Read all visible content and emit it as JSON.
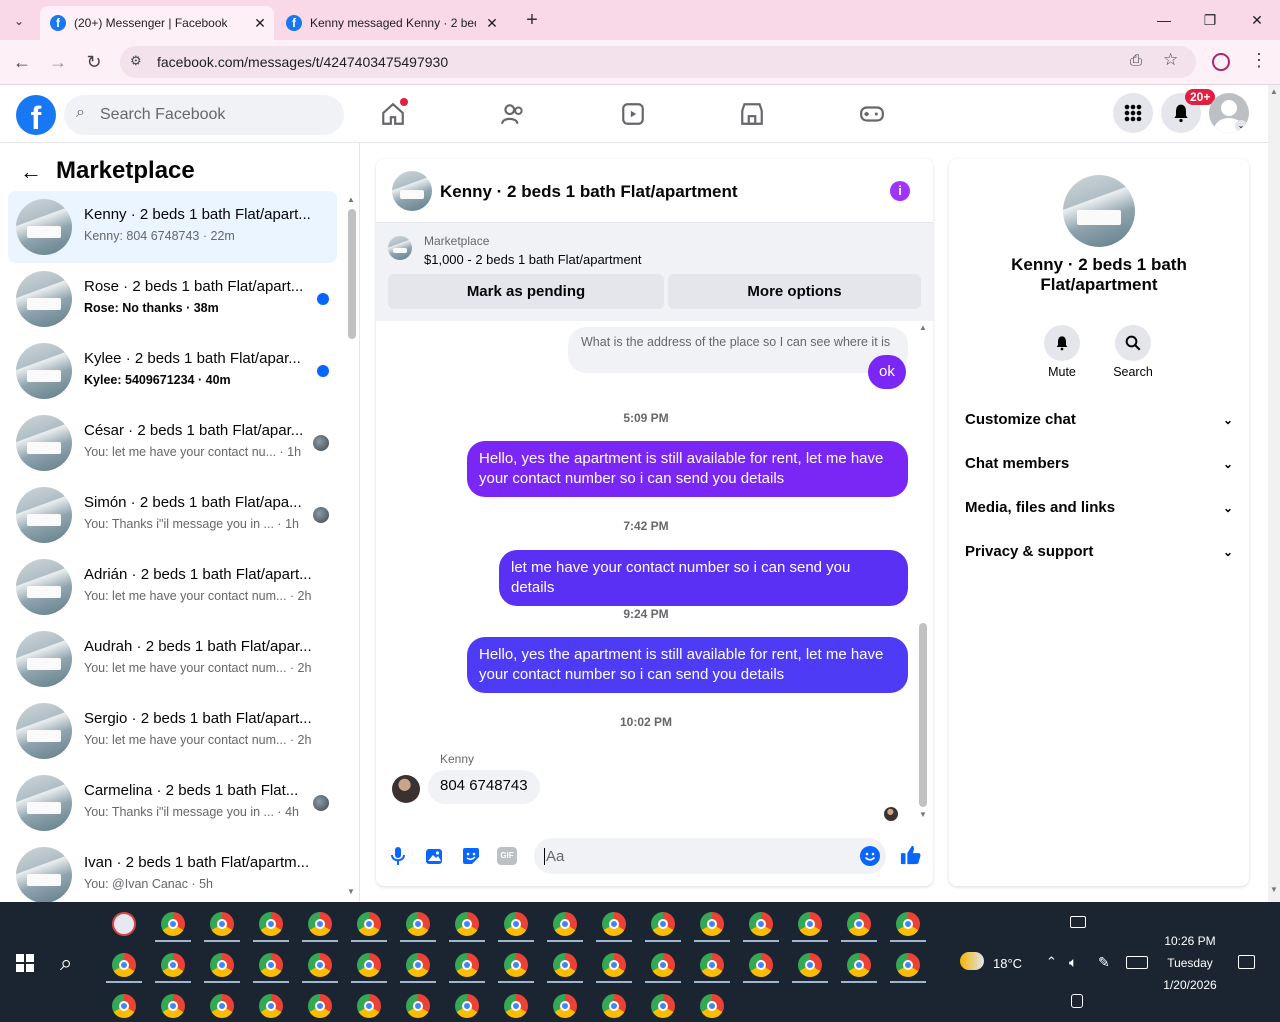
{
  "browser": {
    "tabs": [
      {
        "title": "(20+) Messenger | Facebook",
        "close": "✕"
      },
      {
        "title": "Kenny messaged Kenny · 2 bed",
        "close": "✕"
      }
    ],
    "new_tab": "+",
    "url": "facebook.com/messages/t/4247403475497930"
  },
  "fb": {
    "logo": "f",
    "search_placeholder": "Search Facebook",
    "notif_badge": "20+"
  },
  "sidebar": {
    "title": "Marketplace",
    "conversations": [
      {
        "name": "Kenny · 2 beds 1 bath Flat/apart...",
        "preview": "Kenny: 804 6748743 · 22m",
        "selected": true,
        "unread": false
      },
      {
        "name": "Rose · 2 beds 1 bath Flat/apart...",
        "preview": "Rose: No thanks · 38m",
        "unread": true
      },
      {
        "name": "Kylee · 2 beds 1 bath Flat/apar...",
        "preview": "Kylee: 5409671234 · 40m",
        "unread": true
      },
      {
        "name": "César · 2 beds 1 bath Flat/apar...",
        "preview": "You: let me have your contact nu... · 1h",
        "seen": true
      },
      {
        "name": "Simón · 2 beds 1 bath Flat/apa...",
        "preview": "You: Thanks i\"il message you in ... · 1h",
        "seen": true
      },
      {
        "name": "Adrián · 2 beds 1 bath Flat/apart...",
        "preview": "You: let me have your contact num... · 2h"
      },
      {
        "name": "Audrah · 2 beds 1 bath Flat/apar...",
        "preview": "You: let me have your contact num... · 2h"
      },
      {
        "name": "Sergio · 2 beds 1 bath Flat/apart...",
        "preview": "You: let me have your contact num... · 2h"
      },
      {
        "name": "Carmelina · 2 beds 1 bath Flat...",
        "preview": "You: Thanks i\"il message you in ... · 4h",
        "seen": true
      },
      {
        "name": "Ivan · 2 beds 1 bath Flat/apartm...",
        "preview": "You: @Ivan Canac · 5h"
      }
    ]
  },
  "chat": {
    "title": "Kenny · 2 beds 1 bath Flat/apartment",
    "marketplace_label": "Marketplace",
    "listing": "$1,000 - 2 beds 1 bath Flat/apartment",
    "mark_pending": "Mark as pending",
    "more_options": "More options",
    "messages": {
      "quoted": "What is the address of the place so I can see where it is",
      "ok": "ok",
      "time1": "5:09 PM",
      "msg1": "Hello, yes the apartment is still available for rent, let me have your contact number so i can send you details",
      "time2": "7:42 PM",
      "msg2": "let me have your contact number so i can send you details",
      "time3": "9:24 PM",
      "msg3": "Hello, yes the apartment is still available for rent, let me have your contact number so i can send you details",
      "time4": "10:02 PM",
      "sender": "Kenny",
      "incoming": "804 6748743"
    },
    "input_placeholder": "Aa"
  },
  "info": {
    "name": "Kenny · 2 beds 1 bath Flat/apartment",
    "mute": "Mute",
    "search": "Search",
    "sections": [
      "Customize chat",
      "Chat members",
      "Media, files and links",
      "Privacy & support"
    ]
  },
  "taskbar": {
    "weather": "18°C",
    "time": "10:26 PM",
    "day": "Tuesday",
    "date": "1/20/2026"
  },
  "colors": {
    "fb_blue": "#1877f2",
    "bubble_purple": "#7a26f5",
    "bubble_blue": "#4d3bf5",
    "unread_dot": "#0866ff"
  }
}
